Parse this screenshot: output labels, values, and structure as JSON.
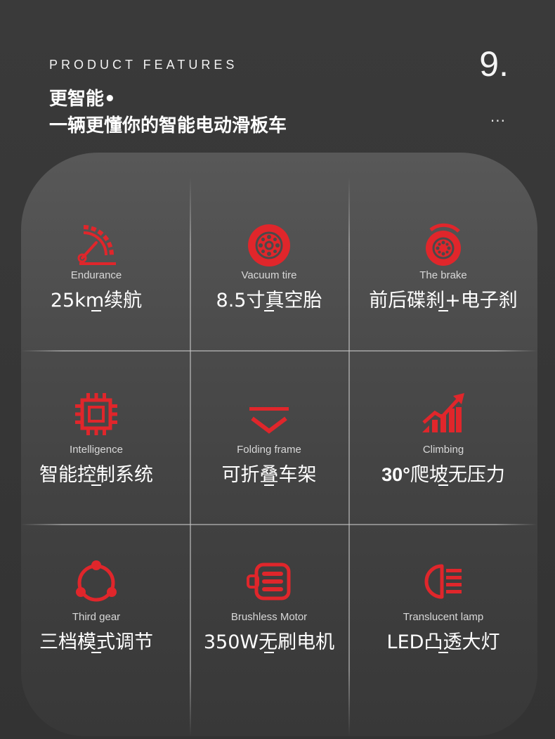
{
  "header": {
    "eyebrow": "PRODUCT FEATURES",
    "page_number": "9.",
    "heading_line1": "更智能•",
    "heading_line2": "一辆更懂你的智能电动滑板车",
    "more": "···"
  },
  "colors": {
    "accent": "#e0262b",
    "background": "#363636",
    "panel": "#4c4c4c",
    "text": "#ffffff"
  },
  "features": [
    {
      "icon": "speedometer-icon",
      "en": "Endurance",
      "cn": "25km续航",
      "dash": "—"
    },
    {
      "icon": "tire-icon",
      "en": "Vacuum tire",
      "cn": "8.5寸真空胎",
      "dash": "—"
    },
    {
      "icon": "brake-disc-icon",
      "en": "The brake",
      "cn": "前后碟刹+电子刹",
      "dash": "—"
    },
    {
      "icon": "chip-icon",
      "en": "Intelligence",
      "cn": "智能控制系统",
      "dash": "—"
    },
    {
      "icon": "fold-chevron-icon",
      "en": "Folding frame",
      "cn": "可折叠车架",
      "dash": "—"
    },
    {
      "icon": "growth-chart-icon",
      "en": "Climbing",
      "cn_bold": "30°",
      "cn": "爬坡无压力",
      "dash": "—"
    },
    {
      "icon": "three-gear-icon",
      "en": "Third gear",
      "cn": "三档模式调节",
      "dash": "—"
    },
    {
      "icon": "motor-icon",
      "en": "Brushless Motor",
      "cn": "350W无刷电机",
      "dash": "—"
    },
    {
      "icon": "headlamp-icon",
      "en": "Translucent lamp",
      "cn": "LED凸透大灯",
      "dash": "—"
    }
  ]
}
